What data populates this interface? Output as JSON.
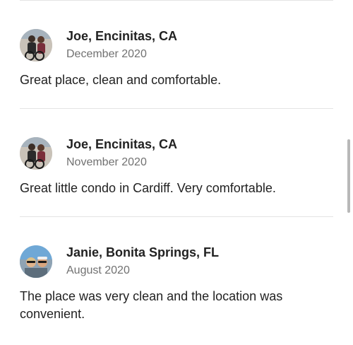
{
  "reviews": [
    {
      "name": "Joe, Encinitas, CA",
      "date": "December 2020",
      "text": "Great place, clean and comfortable.",
      "avatar": "avatar-photo-couple-bike"
    },
    {
      "name": "Joe, Encinitas, CA",
      "date": "November 2020",
      "text": "Great little condo in Cardiff.  Very comfortable.",
      "avatar": "avatar-photo-couple-bike"
    },
    {
      "name": "Janie, Bonita Springs, FL",
      "date": "August 2020",
      "text": "The place was very clean and the location was convenient.",
      "avatar": "avatar-photo-couple-beach"
    }
  ],
  "colors": {
    "text": "#222222",
    "secondary_text": "#717171",
    "divider": "#e4e4e4",
    "scrollbar": "#b8b8b8"
  }
}
